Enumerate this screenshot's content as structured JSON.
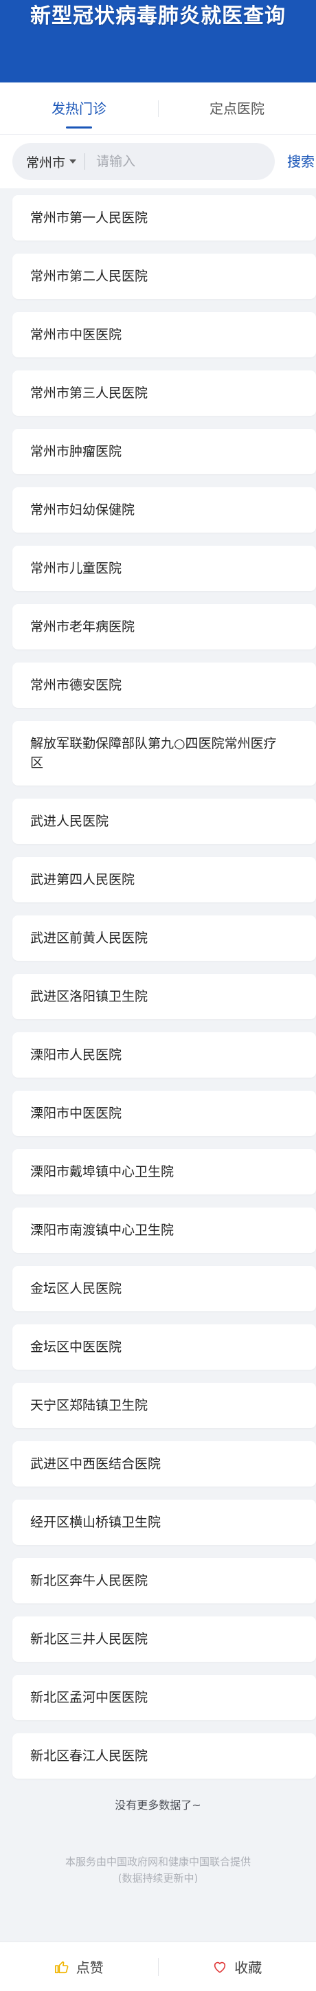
{
  "header": {
    "title": "新型冠状病毒肺炎就医查询"
  },
  "tabs": [
    {
      "label": "发热门诊",
      "active": true
    },
    {
      "label": "定点医院",
      "active": false
    }
  ],
  "search": {
    "city": "常州市",
    "placeholder": "请输入",
    "value": "",
    "button_label": "搜索"
  },
  "hospitals": [
    "常州市第一人民医院",
    "常州市第二人民医院",
    "常州市中医医院",
    "常州市第三人民医院",
    "常州市肿瘤医院",
    "常州市妇幼保健院",
    "常州市儿童医院",
    "常州市老年病医院",
    "常州市德安医院",
    "解放军联勤保障部队第九○四医院常州医疗区",
    "武进人民医院",
    "武进第四人民医院",
    "武进区前黄人民医院",
    "武进区洛阳镇卫生院",
    "溧阳市人民医院",
    "溧阳市中医医院",
    "溧阳市戴埠镇中心卫生院",
    "溧阳市南渡镇中心卫生院",
    "金坛区人民医院",
    "金坛区中医医院",
    "天宁区郑陆镇卫生院",
    "武进区中西医结合医院",
    "经开区横山桥镇卫生院",
    "新北区奔牛人民医院",
    "新北区三井人民医院",
    "新北区孟河中医医院",
    "新北区春江人民医院"
  ],
  "footer": {
    "no_more": "没有更多数据了~",
    "disclaimer_line1": "本服务由中国政府网和健康中国联合提供",
    "disclaimer_line2": "(数据持续更新中)"
  },
  "bottom_bar": {
    "like_label": "点赞",
    "like_icon": "thumbs-up-icon",
    "favorite_label": "收藏",
    "favorite_icon": "heart-icon"
  },
  "colors": {
    "primary": "#1a56b8",
    "background": "#f1f3f6",
    "like_icon": "#f0b400",
    "favorite_icon": "#e03a3a"
  }
}
